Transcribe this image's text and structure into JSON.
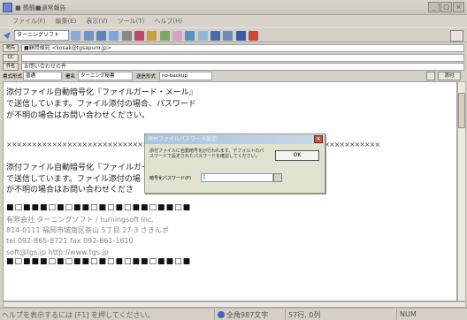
{
  "window": {
    "title": "■ 鶴鶴■通常報告"
  },
  "menu": [
    "ファイル(F)",
    "編集(E)",
    "表示(V)",
    "ツール(T)",
    "ヘルプ(H)"
  ],
  "toolbar": {
    "account": "ターニングソフト"
  },
  "header": {
    "to_label": "宛先",
    "to_value": "■顧問様宛 <kosak@tgsapuro.jp>",
    "cc_label": "CC",
    "cc_value": "",
    "subject_label": "件名",
    "subject_value": "お問い合わせの件",
    "attr_format_label": "書式形式",
    "attr_format_value": "普通",
    "attr_sig_label": "署名",
    "attr_sig_value": "ターニング秘書",
    "attr_send_label": "送信形式",
    "attr_send_value": "no-backup",
    "attach_btn": "添付"
  },
  "body": {
    "line1": "添付ファイル自動暗号化『ファイルガード・メール』",
    "line2": "で送信しています。ファイル添付の場合、パスワード",
    "line3": "が不明の場合はお問い合わせください。",
    "separator": "××××××××××××××××××××××××××××××××××××××××××××××××××××××××××××××××××××××××××",
    "line4": "添付ファイル自動暗号化『ファイルガード・メール』",
    "line5": "で送信しています。ファイル添付の場",
    "line6": "が不明の場合はお問い合わせくださ",
    "blocks_top": "■□■■■□■□■■□■□■□■■□■■□■",
    "sig1": "有限会社 ターニングソフト / turningsoft Inc.",
    "sig2": "814-0111  福岡市城南区茶山 5丁目 27-3  さきんポ",
    "sig3": "tel 092-865-8721  fax 092-861-1610",
    "sig4": "soft@tgs.jp    http://www.tgs.jp",
    "blocks_bottom": "■□■■■□■□■■□■□■□■■□■■□■"
  },
  "dialog": {
    "title": "添付ファイルパスワード設定",
    "message": "添付ファイルに自動暗号化が行われます。デフォルトのパスワードで設定されたパスワードを確認してください。",
    "ok": "OK",
    "password_label": "暗号化パスワード(P)",
    "password_value": "|"
  },
  "status": {
    "help": "ヘルプを表示するには [F1] を押してください。",
    "chars": "全角987文字",
    "position": "57行, 0列",
    "num": "NUM"
  },
  "colors": {
    "accent": "#3a6ab8",
    "dialog_title": "#a8c4dc",
    "close": "#c8503a"
  }
}
